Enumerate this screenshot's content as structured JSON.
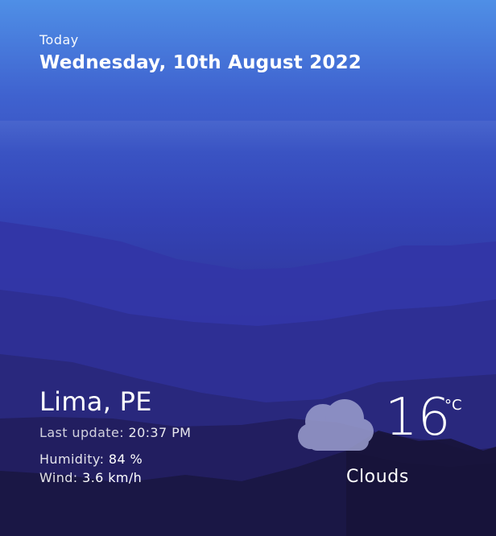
{
  "header": {
    "today_label": "Today",
    "date": "Wednesday, 10th August 2022"
  },
  "location": {
    "city": "Lima, PE",
    "last_update_label": "Last update:",
    "last_update_time": "20:37 PM",
    "humidity_label": "Humidity:",
    "humidity_value": "84 %",
    "wind_label": "Wind:",
    "wind_value": "3.6 km/h"
  },
  "weather": {
    "temperature": "16",
    "unit": "°C",
    "condition": "Clouds",
    "icon": "cloud-icon"
  },
  "colors": {
    "sky_top": "#4f8fe6",
    "sky_mid": "#3443b6",
    "mountain_dark": "#1a1745",
    "cloud": "#9c9fcf"
  }
}
